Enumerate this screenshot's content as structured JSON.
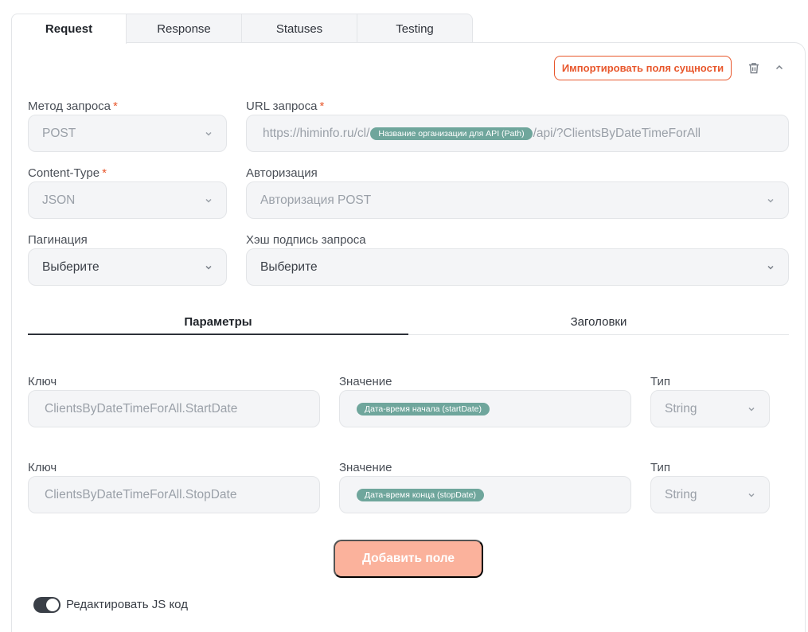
{
  "tabs": [
    "Request",
    "Response",
    "Statuses",
    "Testing"
  ],
  "actions": {
    "import_label": "Импортировать поля сущности",
    "delete_icon": "trash-icon",
    "collapse_icon": "chevron-up-icon"
  },
  "form": {
    "method": {
      "label": "Метод запроса",
      "value": "POST"
    },
    "url": {
      "label": "URL запроса",
      "prefix": "https://himinfo.ru/cl/",
      "chip": "Название организации для API (Path)",
      "suffix": "/api/?ClientsByDateTimeForAll"
    },
    "content_type": {
      "label": "Content-Type",
      "value": "JSON"
    },
    "auth": {
      "label": "Авторизация",
      "value": "Авторизация POST"
    },
    "pagination": {
      "label": "Пагинация",
      "value": "Выберите"
    },
    "hash": {
      "label": "Хэш подпись запроса",
      "value": "Выберите"
    },
    "required_mark": "*"
  },
  "subtabs": [
    "Параметры",
    "Заголовки"
  ],
  "params": [
    {
      "key_label": "Ключ",
      "key": "ClientsByDateTimeForAll.StartDate",
      "value_label": "Значение",
      "value_chip": "Дата-время начала (startDate)",
      "type_label": "Тип",
      "type": "String"
    },
    {
      "key_label": "Ключ",
      "key": "ClientsByDateTimeForAll.StopDate",
      "value_label": "Значение",
      "value_chip": "Дата-время конца (stopDate)",
      "type_label": "Тип",
      "type": "String"
    }
  ],
  "add_field_label": "Добавить поле",
  "js_toggle": {
    "label": "Редактировать JS код",
    "on": true
  },
  "colors": {
    "accent": "#e8572c",
    "chip": "#6fa69c",
    "add_button": "#fbb29c"
  }
}
